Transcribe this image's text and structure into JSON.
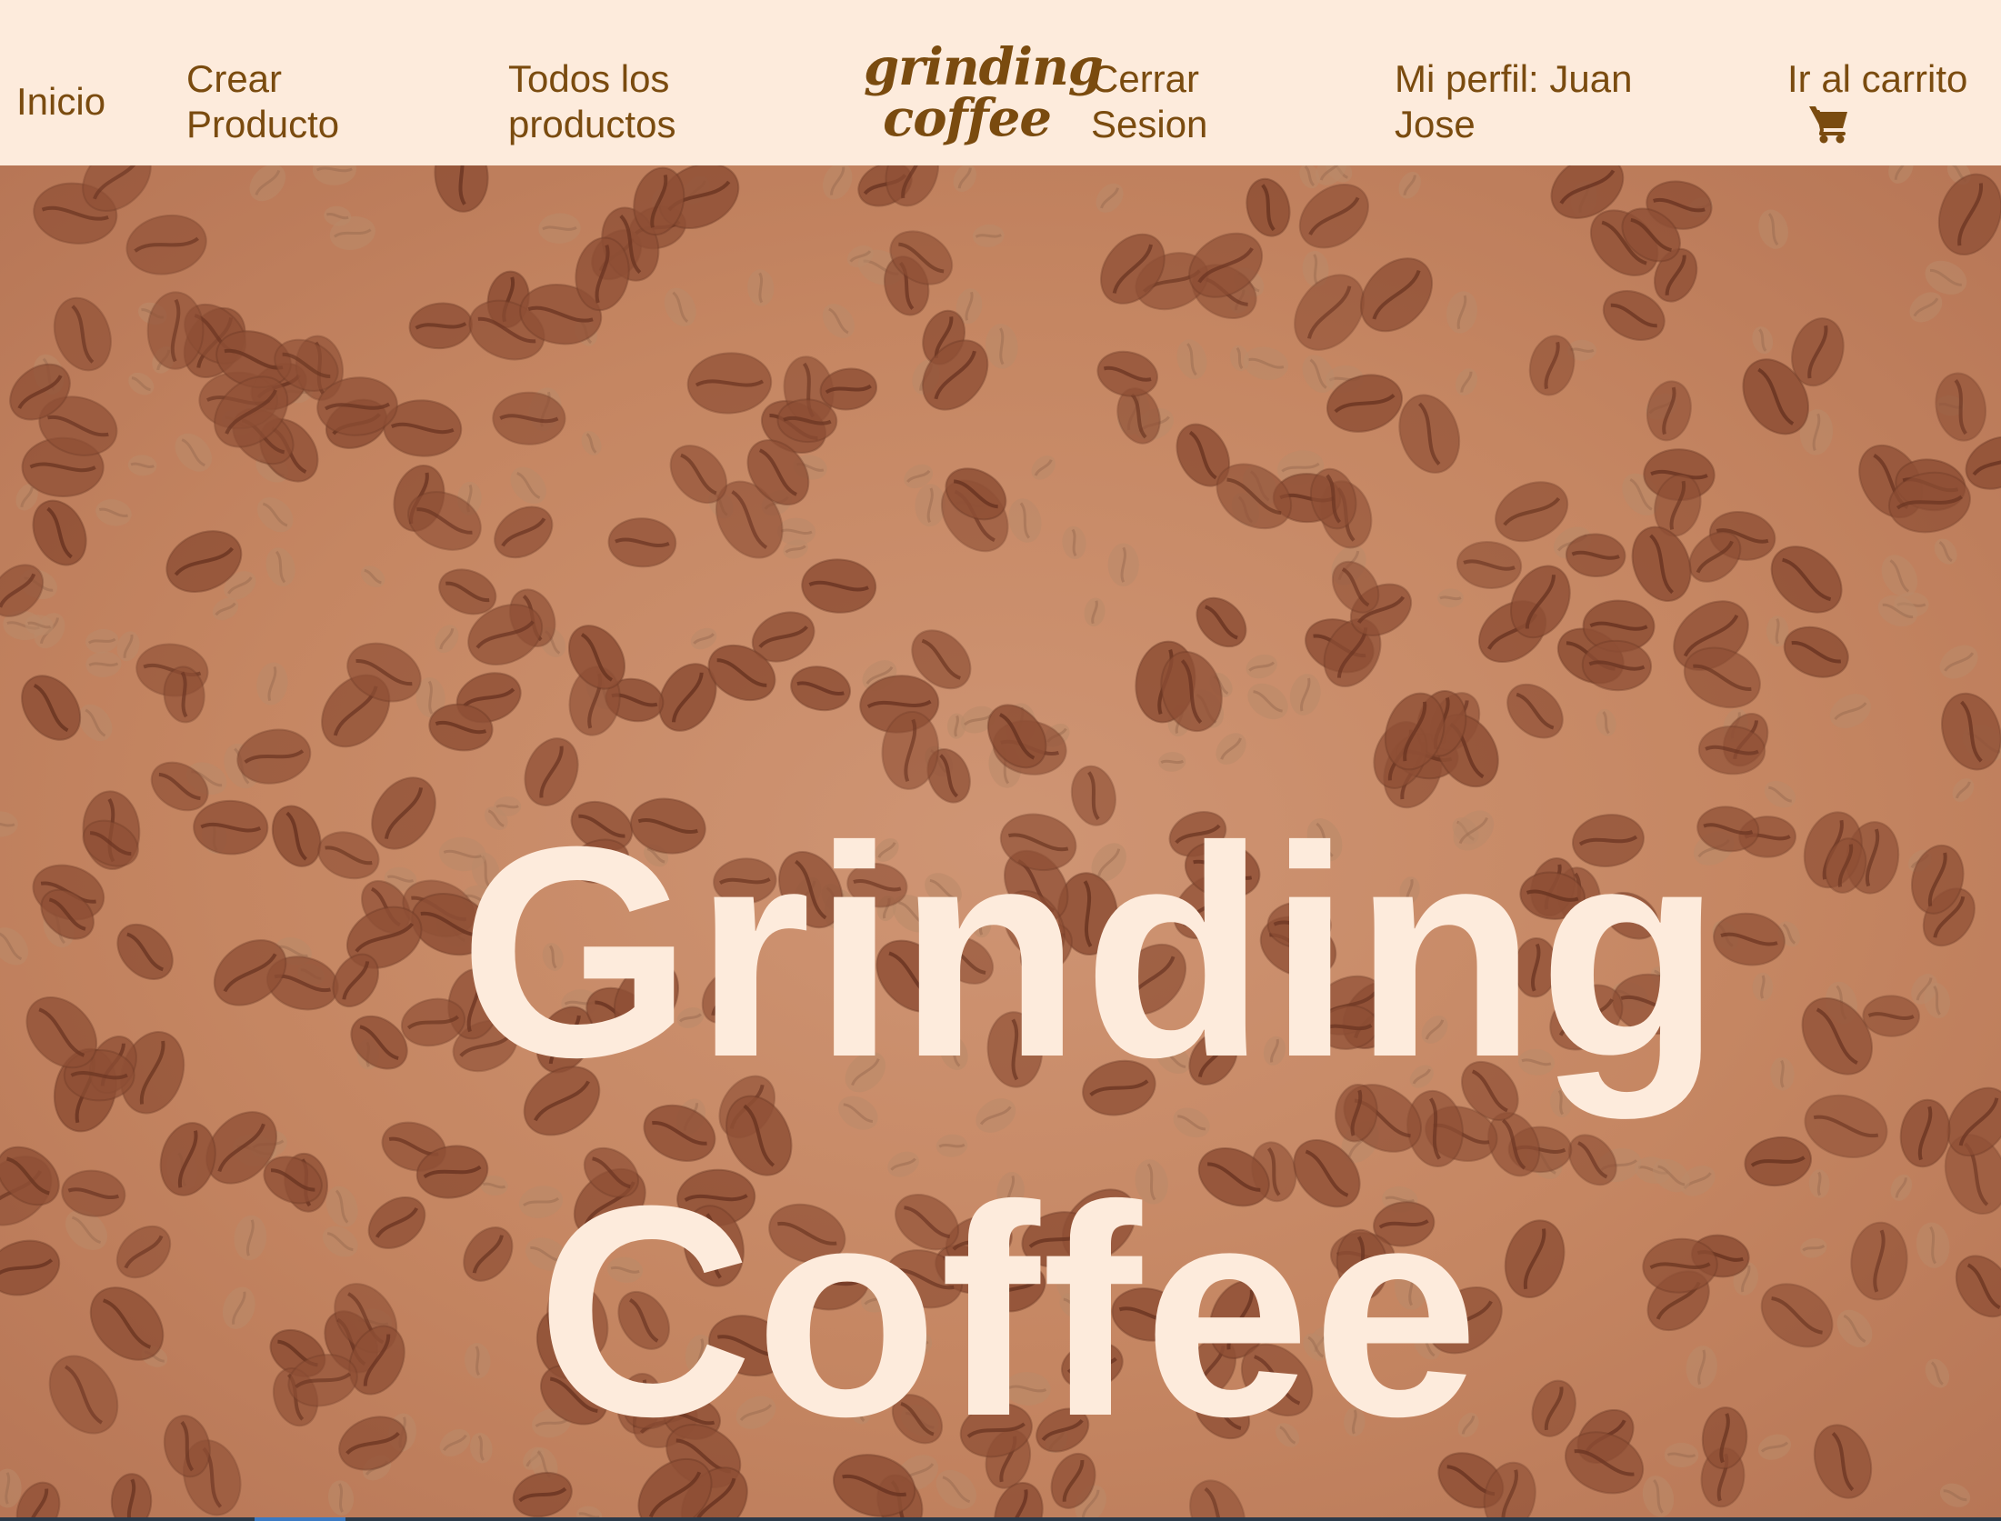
{
  "nav": {
    "inicio": [
      "Inicio"
    ],
    "crear_producto": [
      "Crear",
      "Producto"
    ],
    "todos_productos": [
      "Todos los",
      "productos"
    ],
    "logo": [
      "grinding",
      "coffee"
    ],
    "cerrar_sesion": [
      "Cerrar",
      "Sesion"
    ],
    "mi_perfil": [
      "Mi perfil: Juan",
      "Jose"
    ],
    "carrito": "Ir al carrito",
    "cart_icon": "shopping-cart-icon"
  },
  "hero": {
    "title_line1": "Grinding",
    "title_line2": "Coffee",
    "background": "coffee-beans-pattern"
  },
  "colors": {
    "nav_bg": "#fdebdc",
    "nav_text": "#7a4b0f",
    "hero_bg": "#c58662",
    "hero_text": "#fdebdc",
    "bean": "#8f4f35"
  }
}
